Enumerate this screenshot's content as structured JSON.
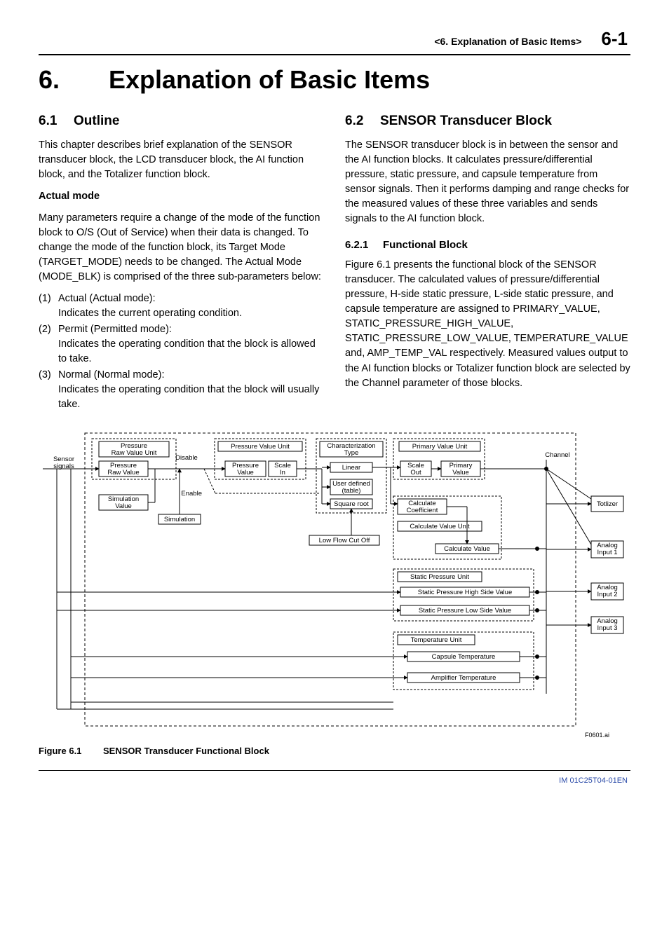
{
  "header": {
    "crumb": "<6.  Explanation of Basic Items>",
    "page": "6-1"
  },
  "title": {
    "num": "6.",
    "text": "Explanation of Basic Items"
  },
  "left": {
    "h2_num": "6.1",
    "h2_text": "Outline",
    "p1": "This chapter describes brief explanation of the SENSOR transducer block, the LCD transducer block, the AI function block, and the Totalizer function block.",
    "sub1": "Actual mode",
    "p2": "Many parameters require a change of the mode of the function block to O/S (Out of Service) when their data is changed. To change the mode of the function block, its Target Mode (TARGET_MODE) needs to be changed. The Actual Mode (MODE_BLK) is comprised of the three sub-parameters below:",
    "items": [
      {
        "idx": "(1)",
        "t": "Actual (Actual mode):",
        "d": "Indicates the current operating condition."
      },
      {
        "idx": "(2)",
        "t": "Permit (Permitted mode):",
        "d": "Indicates the operating condition that the block is allowed to take."
      },
      {
        "idx": "(3)",
        "t": "Normal (Normal mode):",
        "d": "Indicates the operating condition that the block will usually take."
      }
    ]
  },
  "right": {
    "h2_num": "6.2",
    "h2_text": "SENSOR Transducer Block",
    "p1": "The SENSOR transducer block is in between the sensor and the AI function blocks. It calculates pressure/differential pressure, static pressure, and capsule temperature from sensor signals. Then it performs damping and range checks for the measured values of these three variables and sends signals to the AI function block.",
    "h3_num": "6.2.1",
    "h3_text": "Functional Block",
    "p2": "Figure 6.1 presents the functional block of the SENSOR transducer. The calculated values of pressure/differential pressure, H-side static pressure, L-side static pressure, and capsule temperature are assigned to PRIMARY_VALUE, STATIC_PRESSURE_HIGH_VALUE, STATIC_PRESSURE_LOW_VALUE, TEMPERATURE_VALUE and, AMP_TEMP_VAL respectively. Measured values output to the AI function blocks or Totalizer function block are selected by the Channel parameter of those blocks."
  },
  "diag": {
    "sensor_signals": "Sensor\nsignals",
    "prv_unit": "Pressure\nRaw Value Unit",
    "prv": "Pressure\nRaw Value",
    "disable": "Disable",
    "enable": "Enable",
    "sim_val": "Simulation\nValue",
    "simulation": "Simulation",
    "pv_unit": "Pressure Value Unit",
    "pv": "Pressure\nValue",
    "scale_in": "Scale\nIn",
    "char_type": "Characterization\nType",
    "linear": "Linear",
    "user_def": "User defined\n(table)",
    "sqrt": "Square root",
    "lfc": "Low Flow Cut Off",
    "scale_out": "Scale\nOut",
    "primary_unit": "Primary Value Unit",
    "primary": "Primary\nValue",
    "calc_coeff": "Calculate\nCoefficient",
    "calc_unit": "Calculate Value Unit",
    "calc_val": "Calculate Value",
    "sp_unit": "Static Pressure Unit",
    "sp_high": "Static Pressure High Side Value",
    "sp_low": "Static Pressure Low Side Value",
    "temp_unit": "Temperature Unit",
    "cap_temp": "Capsule Temperature",
    "amp_temp": "Amplifier Temperature",
    "channel": "Channel",
    "totlizer": "Totlizer",
    "ai1": "Analog\nInput 1",
    "ai2": "Analog\nInput 2",
    "ai3": "Analog\nInput 3",
    "ref": "F0601.ai"
  },
  "figcap": {
    "label": "Figure 6.1",
    "text": "SENSOR Transducer Functional Block"
  },
  "footer": {
    "id": "IM 01C25T04-01EN"
  }
}
